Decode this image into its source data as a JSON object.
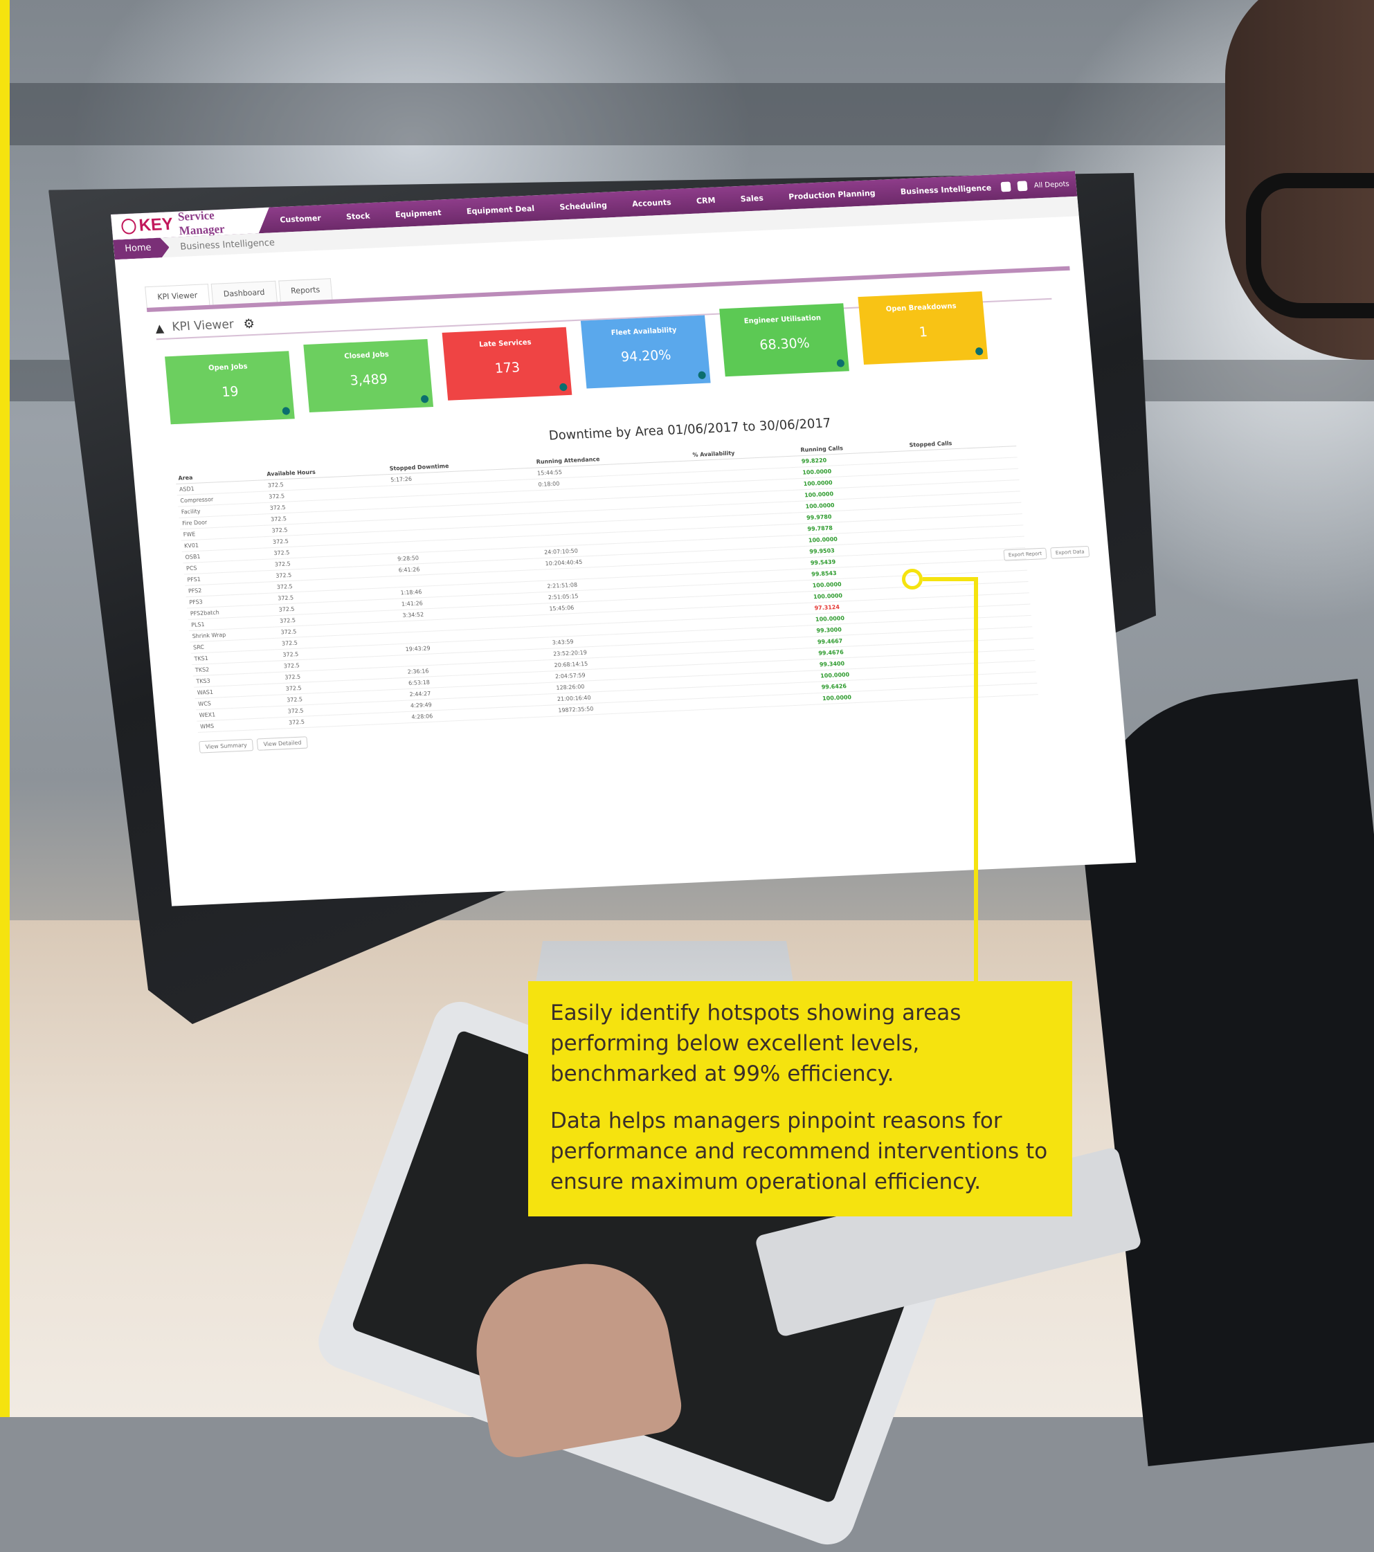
{
  "app": {
    "logo_brand": "KEY",
    "logo_title": "Service Manager",
    "menu": [
      "Customer",
      "Stock",
      "Equipment",
      "Equipment Deal",
      "Scheduling",
      "Accounts",
      "CRM",
      "Sales",
      "Production Planning",
      "Business Intelligence"
    ],
    "depot": "All Depots"
  },
  "breadcrumb": {
    "home": "Home",
    "current": "Business Intelligence"
  },
  "tabs": [
    "KPI Viewer",
    "Dashboard",
    "Reports"
  ],
  "kpi": {
    "header": "KPI Viewer",
    "tiles": [
      {
        "title": "Open Jobs",
        "value": "19",
        "color": "#6ccf5f"
      },
      {
        "title": "Closed Jobs",
        "value": "3,489",
        "color": "#6ccf5f"
      },
      {
        "title": "Late Services",
        "value": "173",
        "color": "#ef4444"
      },
      {
        "title": "Fleet Availability",
        "value": "94.20%",
        "color": "#5aa8ec"
      },
      {
        "title": "Engineer Utilisation",
        "value": "68.30%",
        "color": "#5cc954"
      },
      {
        "title": "Open Breakdowns",
        "value": "1",
        "color": "#f8c315"
      }
    ]
  },
  "report": {
    "title": "Downtime by Area 01/06/2017 to 30/06/2017",
    "columns": [
      "Area",
      "Available Hours",
      "Stopped Downtime",
      "Running Attendance",
      "% Availability",
      "Running Calls",
      "Stopped Calls"
    ],
    "rows": [
      [
        "ASD1",
        "372.5",
        "5:17:26",
        "15:44:55",
        "",
        "99.8220",
        "",
        ""
      ],
      [
        "Compressor",
        "372.5",
        "",
        "0:18:00",
        "",
        "100.0000",
        "",
        ""
      ],
      [
        "Facility",
        "372.5",
        "",
        "",
        "",
        "100.0000",
        "",
        ""
      ],
      [
        "Fire Door",
        "372.5",
        "",
        "",
        "",
        "100.0000",
        "",
        ""
      ],
      [
        "FWE",
        "372.5",
        "",
        "",
        "",
        "100.0000",
        "",
        ""
      ],
      [
        "KV01",
        "372.5",
        "",
        "",
        "",
        "99.9780",
        "",
        ""
      ],
      [
        "OSB1",
        "372.5",
        "",
        "",
        "",
        "99.7878",
        "",
        ""
      ],
      [
        "PCS",
        "372.5",
        "9:28:50",
        "24:07:10:50",
        "",
        "100.0000",
        "",
        ""
      ],
      [
        "PFS1",
        "372.5",
        "6:41:26",
        "10:204:40:45",
        "",
        "99.9503",
        "",
        ""
      ],
      [
        "PFS2",
        "372.5",
        "",
        "",
        "",
        "99.5439",
        "",
        ""
      ],
      [
        "PFS3",
        "372.5",
        "1:18:46",
        "2:21:51:08",
        "",
        "99.8543",
        "",
        ""
      ],
      [
        "PFS2batch",
        "372.5",
        "1:41:26",
        "2:51:05:15",
        "",
        "100.0000",
        "",
        ""
      ],
      [
        "PLS1",
        "372.5",
        "3:34:52",
        "15:45:06",
        "",
        "100.0000",
        "",
        ""
      ],
      [
        "Shrink Wrap",
        "372.5",
        "",
        "",
        "",
        "97.3124",
        "",
        ""
      ],
      [
        "SRC",
        "372.5",
        "",
        "",
        "",
        "100.0000",
        "",
        ""
      ],
      [
        "TKS1",
        "372.5",
        "19:43:29",
        "3:43:59",
        "",
        "99.3000",
        "",
        ""
      ],
      [
        "TKS2",
        "372.5",
        "",
        "23:52:20:19",
        "",
        "99.4667",
        "",
        ""
      ],
      [
        "TKS3",
        "372.5",
        "2:36:16",
        "20:68:14:15",
        "",
        "99.4676",
        "",
        ""
      ],
      [
        "WAS1",
        "372.5",
        "6:53:18",
        "2:04:57:59",
        "",
        "99.3400",
        "",
        ""
      ],
      [
        "WCS",
        "372.5",
        "2:44:27",
        "128:26:00",
        "",
        "100.0000",
        "",
        ""
      ],
      [
        "WEX1",
        "372.5",
        "4:29:49",
        "21:00:16:40",
        "",
        "99.6426",
        "",
        ""
      ],
      [
        "WMS",
        "372.5",
        "4:28:06",
        "19872:35:50",
        "",
        "100.0000",
        "",
        ""
      ]
    ],
    "hotspot_value": "97.3124",
    "buttons": [
      "View Summary",
      "View Detailed"
    ],
    "exports": [
      "Export Report",
      "Export Data"
    ]
  },
  "callout": {
    "paragraph1": "Easily identify hotspots showing areas performing below excellent levels, benchmarked at 99% efficiency.",
    "paragraph2": "Data helps managers pinpoint reasons for performance and recommend interventions to ensure maximum operational efficiency.",
    "color": "#f5e30f"
  }
}
